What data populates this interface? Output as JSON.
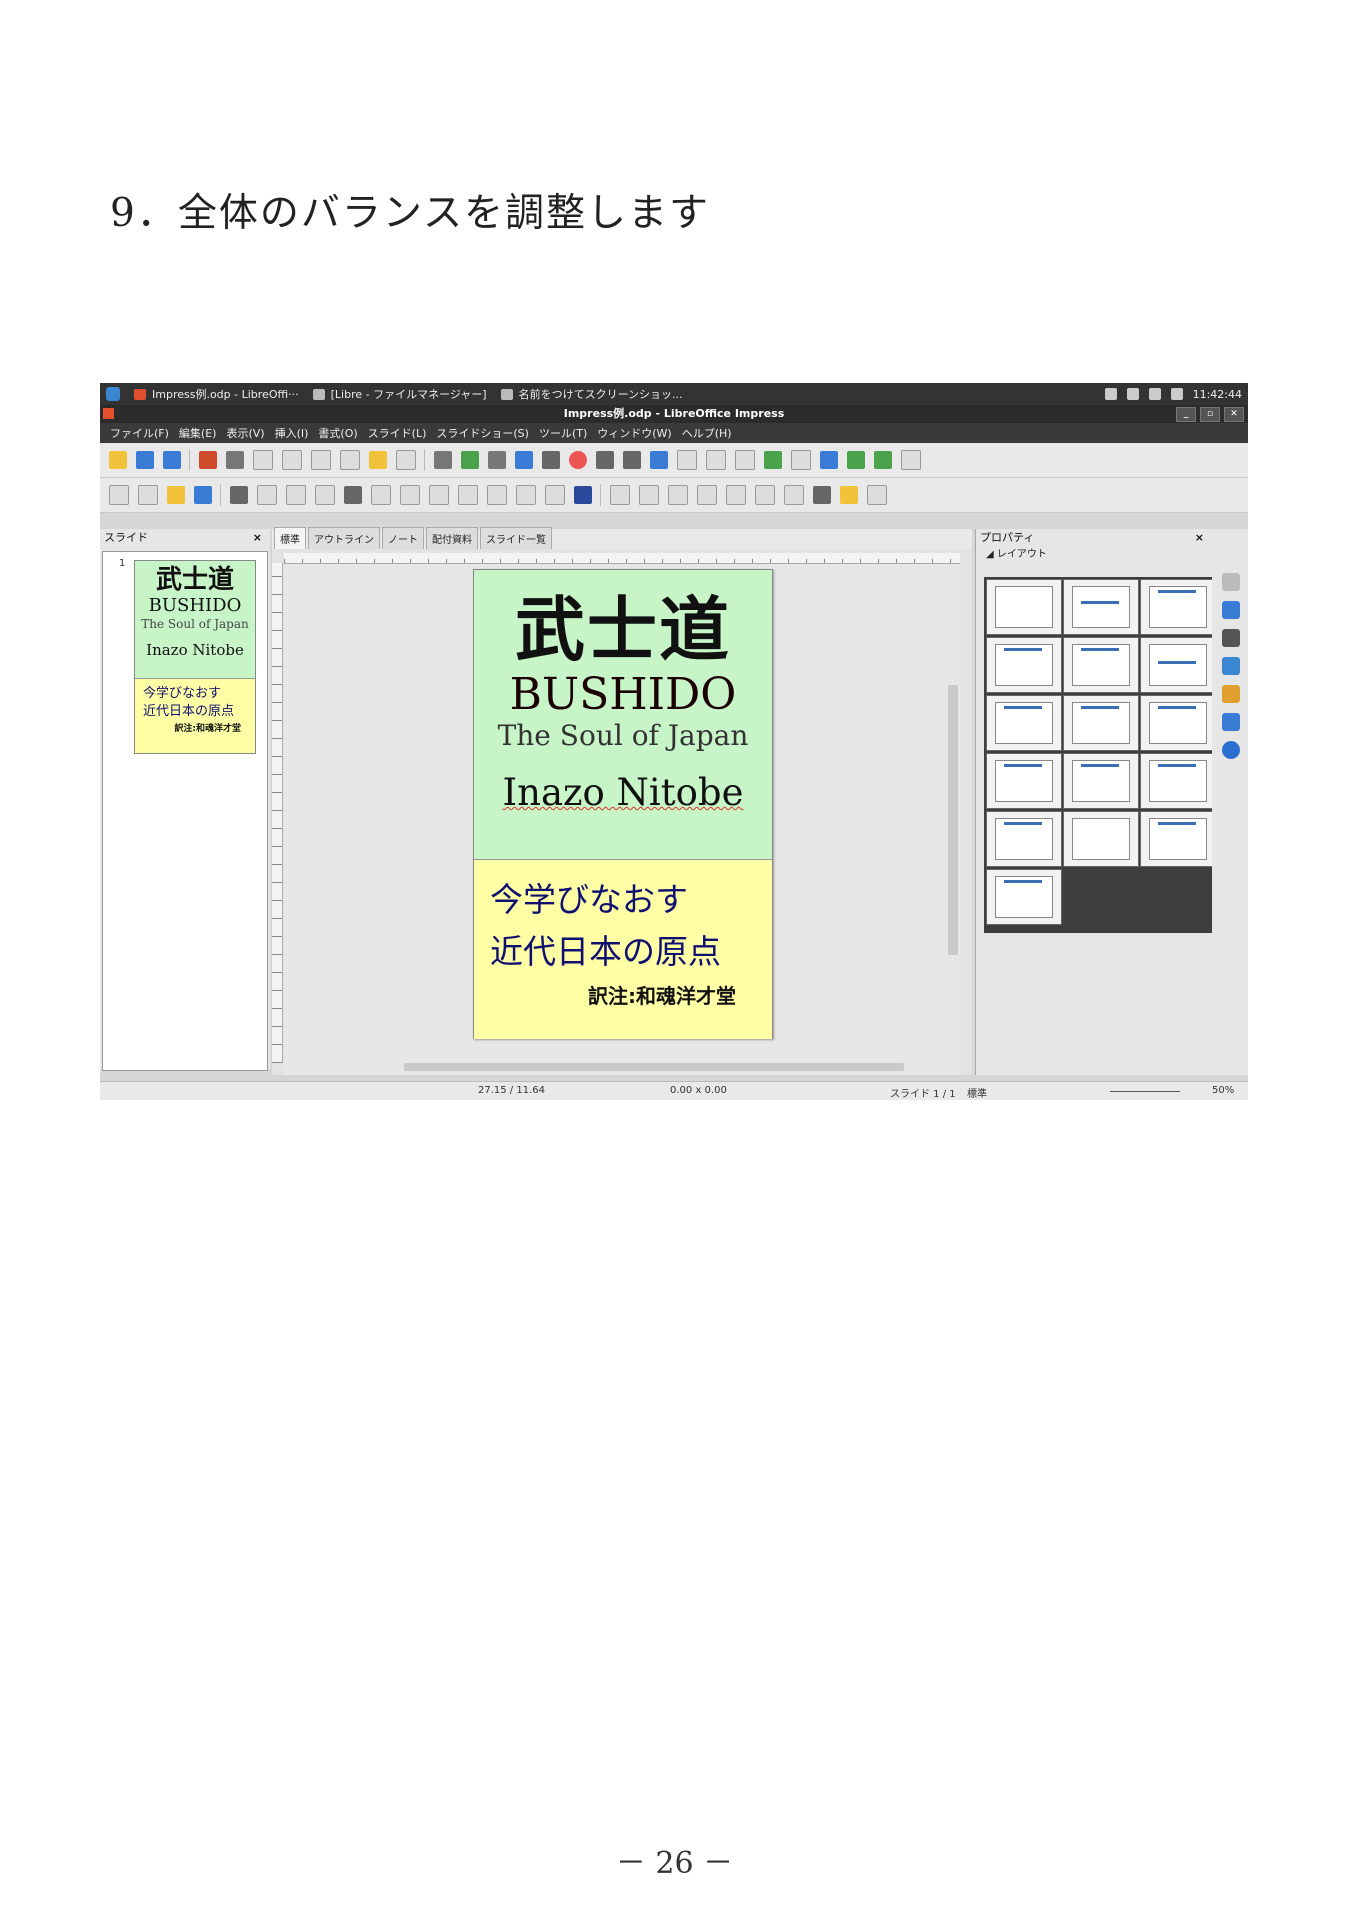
{
  "heading": "9．全体のバランスを調整します",
  "page_number": "－ 26 －",
  "taskbar": {
    "tasks": [
      "Impress例.odp - LibreOffi···",
      "[Libre - ファイルマネージャー]",
      "名前をつけてスクリーンショッ..."
    ],
    "clock": "11:42:44"
  },
  "window_title": "Impress例.odp - LibreOffice Impress",
  "menu": [
    "ファイル(F)",
    "編集(E)",
    "表示(V)",
    "挿入(I)",
    "書式(O)",
    "スライド(L)",
    "スライドショー(S)",
    "ツール(T)",
    "ウィンドウ(W)",
    "ヘルプ(H)"
  ],
  "slide_pane": {
    "title": "スライド",
    "close": "×",
    "slide_number": "1"
  },
  "view_tabs": [
    "標準",
    "アウトライン",
    "ノート",
    "配付資料",
    "スライド一覧"
  ],
  "slide": {
    "kanji": "武士道",
    "bushido": "BUSHIDO",
    "subtitle": "The Soul of Japan",
    "author": "Inazo Nitobe",
    "line1": "今学びなおす",
    "line2": "近代日本の原点",
    "translator": "訳注:和魂洋才堂"
  },
  "properties": {
    "title": "プロパティ",
    "close": "×",
    "section": "◢ レイアウト"
  },
  "status": {
    "position": "27.15 / 11.64",
    "size": "0.00 x 0.00",
    "slide_info": "スライド 1 / 1",
    "master": "標準",
    "zoom": "50%"
  },
  "colors": {
    "title_area": "#c8f5c8",
    "text_area": "#ffffa5",
    "text_blue": "#101070"
  }
}
